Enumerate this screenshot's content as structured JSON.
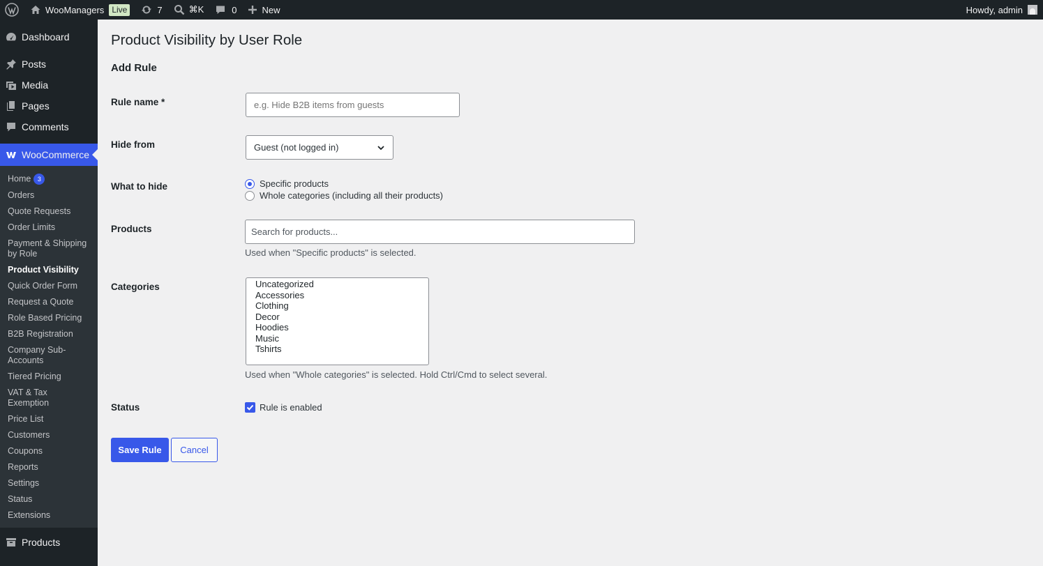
{
  "adminbar": {
    "site_name": "WooManagers",
    "live_badge": "Live",
    "updates_count": "7",
    "search_shortcut": "⌘K",
    "comments_count": "0",
    "new_label": "New",
    "greeting": "Howdy, admin"
  },
  "sidebar": {
    "dashboard": "Dashboard",
    "posts": "Posts",
    "media": "Media",
    "pages": "Pages",
    "comments": "Comments",
    "woocommerce": "WooCommerce",
    "woo_items": [
      {
        "label": "Home",
        "badge": "3"
      },
      {
        "label": "Orders"
      },
      {
        "label": "Quote Requests"
      },
      {
        "label": "Order Limits"
      },
      {
        "label": "Payment & Shipping by Role"
      },
      {
        "label": "Product Visibility",
        "current": true
      },
      {
        "label": "Quick Order Form"
      },
      {
        "label": "Request a Quote"
      },
      {
        "label": "Role Based Pricing"
      },
      {
        "label": "B2B Registration"
      },
      {
        "label": "Company Sub-Accounts"
      },
      {
        "label": "Tiered Pricing"
      },
      {
        "label": "VAT & Tax Exemption"
      },
      {
        "label": "Price List"
      },
      {
        "label": "Customers"
      },
      {
        "label": "Coupons"
      },
      {
        "label": "Reports"
      },
      {
        "label": "Settings"
      },
      {
        "label": "Status"
      },
      {
        "label": "Extensions"
      }
    ],
    "products": "Products"
  },
  "page": {
    "title": "Product Visibility by User Role",
    "section_title": "Add Rule"
  },
  "form": {
    "rule_name_label": "Rule name *",
    "rule_name_placeholder": "e.g. Hide B2B items from guests",
    "hide_from_label": "Hide from",
    "hide_from_value": "Guest (not logged in)",
    "what_to_hide_label": "What to hide",
    "what_to_hide_options": [
      "Specific products",
      "Whole categories (including all their products)"
    ],
    "what_to_hide_selected": "Specific products",
    "products_label": "Products",
    "products_placeholder": "Search for products...",
    "products_help": "Used when \"Specific products\" is selected.",
    "categories_label": "Categories",
    "categories": [
      "Uncategorized",
      "Accessories",
      "Clothing",
      "Decor",
      "Hoodies",
      "Music",
      "Tshirts"
    ],
    "categories_help": "Used when \"Whole categories\" is selected. Hold Ctrl/Cmd to select several.",
    "status_label": "Status",
    "status_checkbox_label": "Rule is enabled",
    "status_checked": true,
    "save_button": "Save Rule",
    "cancel_button": "Cancel"
  },
  "colors": {
    "accent": "#3858e9",
    "sidebar_bg": "#1d2327",
    "submenu_bg": "#2c3338",
    "page_bg": "#f0f0f1"
  }
}
